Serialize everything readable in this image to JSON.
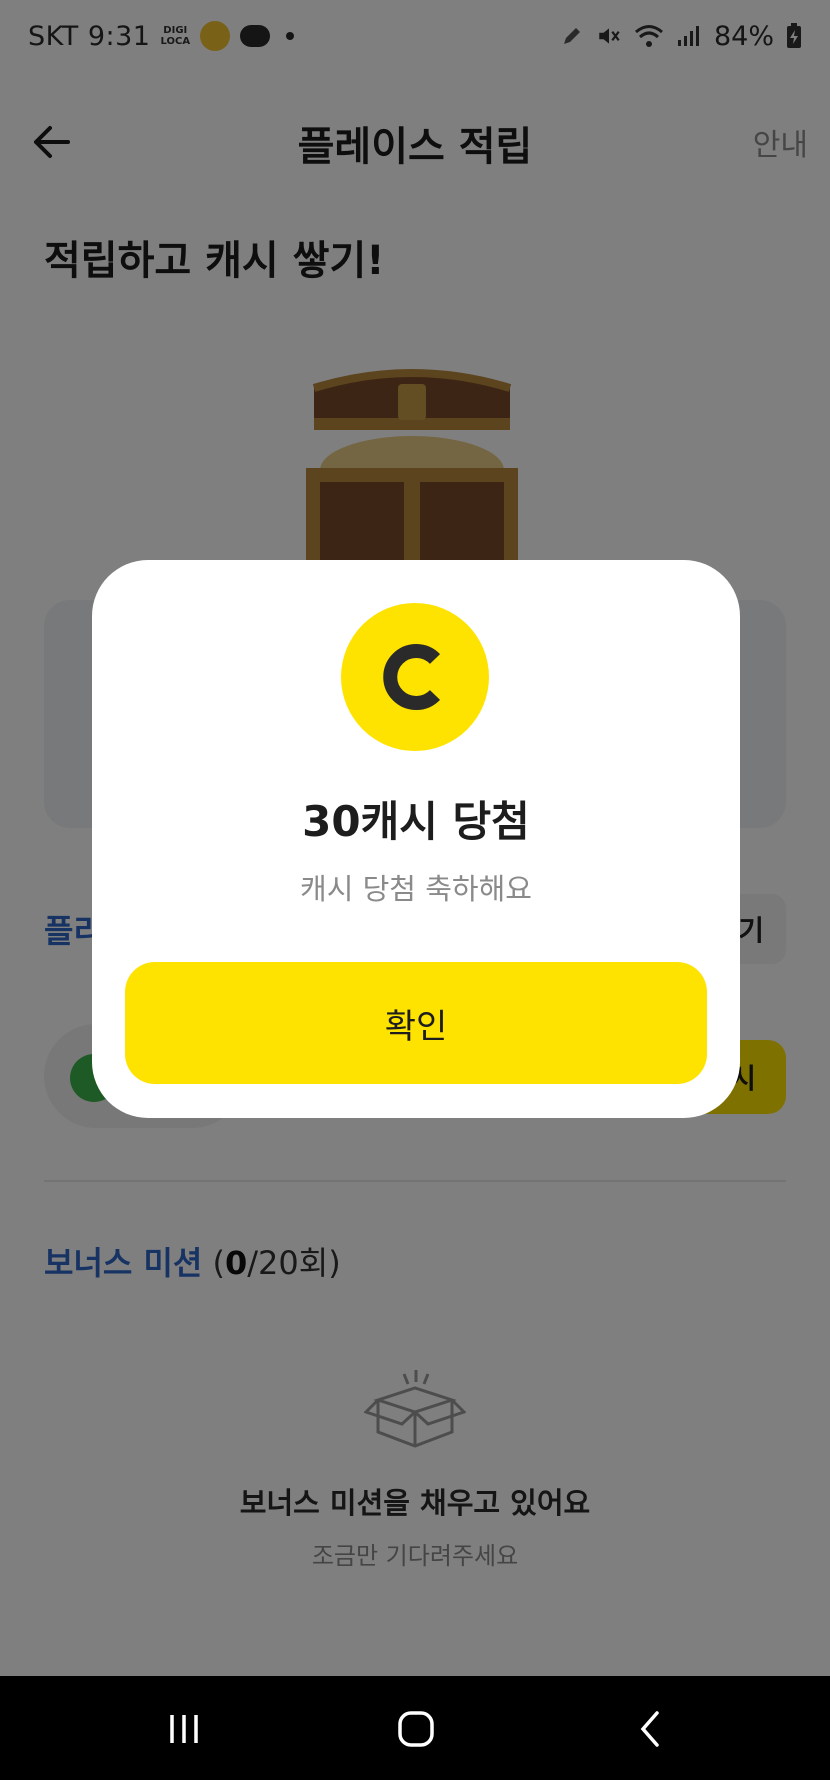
{
  "status_bar": {
    "carrier_time": "SKT 9:31",
    "digi_line1": "DIGI",
    "digi_line2": "LOCA",
    "battery_text": "84%"
  },
  "header": {
    "title": "플레이스 적립",
    "info_link": "안내"
  },
  "hero": {
    "title": "적립하고 캐시 쌓기!"
  },
  "partial": {
    "section_left_label": "플리",
    "section_right_button": "기",
    "action_button": "시"
  },
  "bonus": {
    "title": "보너스 미션",
    "count_open": " (",
    "count_current": "0",
    "count_rest": "/20회)"
  },
  "empty_state": {
    "icon": "open-box-icon",
    "title": "보너스 미션을 채우고 있어요",
    "subtitle": "조금만 기다려주세요"
  },
  "modal": {
    "coin_letter": "C",
    "title": "30캐시 당첨",
    "subtitle": "캐시 당첨 축하해요",
    "confirm_label": "확인"
  },
  "colors": {
    "accent_yellow": "#ffe300",
    "accent_blue": "#2f67c7",
    "overlay": "rgba(0,0,0,0.5)"
  }
}
